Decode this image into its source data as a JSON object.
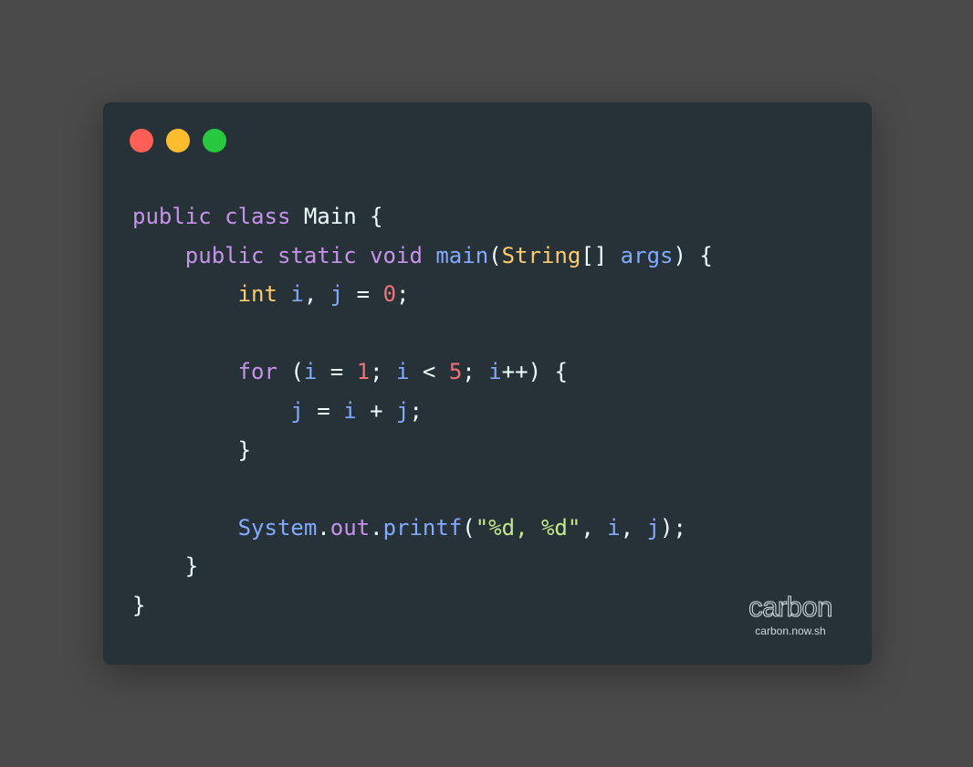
{
  "window": {
    "controls": [
      {
        "name": "close",
        "color": "#ff5f56"
      },
      {
        "name": "minimize",
        "color": "#ffbd2e"
      },
      {
        "name": "zoom",
        "color": "#27c93f"
      }
    ]
  },
  "theme": {
    "background": "#4a4a4a",
    "editor_background": "#263238",
    "default_text": "#eeffff",
    "keyword": "#c792ea",
    "type": "#ffcb6b",
    "variable": "#82aaff",
    "number": "#f07178",
    "string": "#c3e88d"
  },
  "code": {
    "language": "java",
    "lines": [
      [
        {
          "t": "public",
          "c": "keyword"
        },
        {
          "t": " ",
          "c": "default_text"
        },
        {
          "t": "class",
          "c": "keyword"
        },
        {
          "t": " Main {",
          "c": "default_text"
        }
      ],
      [
        {
          "t": "    ",
          "c": "default_text"
        },
        {
          "t": "public",
          "c": "keyword"
        },
        {
          "t": " ",
          "c": "default_text"
        },
        {
          "t": "static",
          "c": "keyword"
        },
        {
          "t": " ",
          "c": "default_text"
        },
        {
          "t": "void",
          "c": "keyword"
        },
        {
          "t": " ",
          "c": "default_text"
        },
        {
          "t": "main",
          "c": "variable"
        },
        {
          "t": "(",
          "c": "default_text"
        },
        {
          "t": "String",
          "c": "type"
        },
        {
          "t": "[] ",
          "c": "default_text"
        },
        {
          "t": "args",
          "c": "variable"
        },
        {
          "t": ") {",
          "c": "default_text"
        }
      ],
      [
        {
          "t": "        ",
          "c": "default_text"
        },
        {
          "t": "int",
          "c": "type"
        },
        {
          "t": " ",
          "c": "default_text"
        },
        {
          "t": "i",
          "c": "variable"
        },
        {
          "t": ", ",
          "c": "default_text"
        },
        {
          "t": "j",
          "c": "variable"
        },
        {
          "t": " = ",
          "c": "default_text"
        },
        {
          "t": "0",
          "c": "number"
        },
        {
          "t": ";",
          "c": "default_text"
        }
      ],
      [],
      [
        {
          "t": "        ",
          "c": "default_text"
        },
        {
          "t": "for",
          "c": "keyword"
        },
        {
          "t": " (",
          "c": "default_text"
        },
        {
          "t": "i",
          "c": "variable"
        },
        {
          "t": " = ",
          "c": "default_text"
        },
        {
          "t": "1",
          "c": "number"
        },
        {
          "t": "; ",
          "c": "default_text"
        },
        {
          "t": "i",
          "c": "variable"
        },
        {
          "t": " < ",
          "c": "default_text"
        },
        {
          "t": "5",
          "c": "number"
        },
        {
          "t": "; ",
          "c": "default_text"
        },
        {
          "t": "i",
          "c": "variable"
        },
        {
          "t": "++",
          "c": "default_text"
        },
        {
          "t": ") {",
          "c": "default_text"
        }
      ],
      [
        {
          "t": "            ",
          "c": "default_text"
        },
        {
          "t": "j",
          "c": "variable"
        },
        {
          "t": " = ",
          "c": "default_text"
        },
        {
          "t": "i",
          "c": "variable"
        },
        {
          "t": " + ",
          "c": "default_text"
        },
        {
          "t": "j",
          "c": "variable"
        },
        {
          "t": ";",
          "c": "default_text"
        }
      ],
      [
        {
          "t": "        }",
          "c": "default_text"
        }
      ],
      [],
      [
        {
          "t": "        ",
          "c": "default_text"
        },
        {
          "t": "System",
          "c": "variable"
        },
        {
          "t": ".",
          "c": "default_text"
        },
        {
          "t": "out",
          "c": "keyword"
        },
        {
          "t": ".",
          "c": "default_text"
        },
        {
          "t": "printf",
          "c": "variable"
        },
        {
          "t": "(",
          "c": "default_text"
        },
        {
          "t": "\"%d, %d\"",
          "c": "string"
        },
        {
          "t": ", ",
          "c": "default_text"
        },
        {
          "t": "i",
          "c": "variable"
        },
        {
          "t": ", ",
          "c": "default_text"
        },
        {
          "t": "j",
          "c": "variable"
        },
        {
          "t": ");",
          "c": "default_text"
        }
      ],
      [
        {
          "t": "    }",
          "c": "default_text"
        }
      ],
      [
        {
          "t": "}",
          "c": "default_text"
        }
      ]
    ]
  },
  "watermark": {
    "logo": "carbon",
    "url": "carbon.now.sh"
  }
}
